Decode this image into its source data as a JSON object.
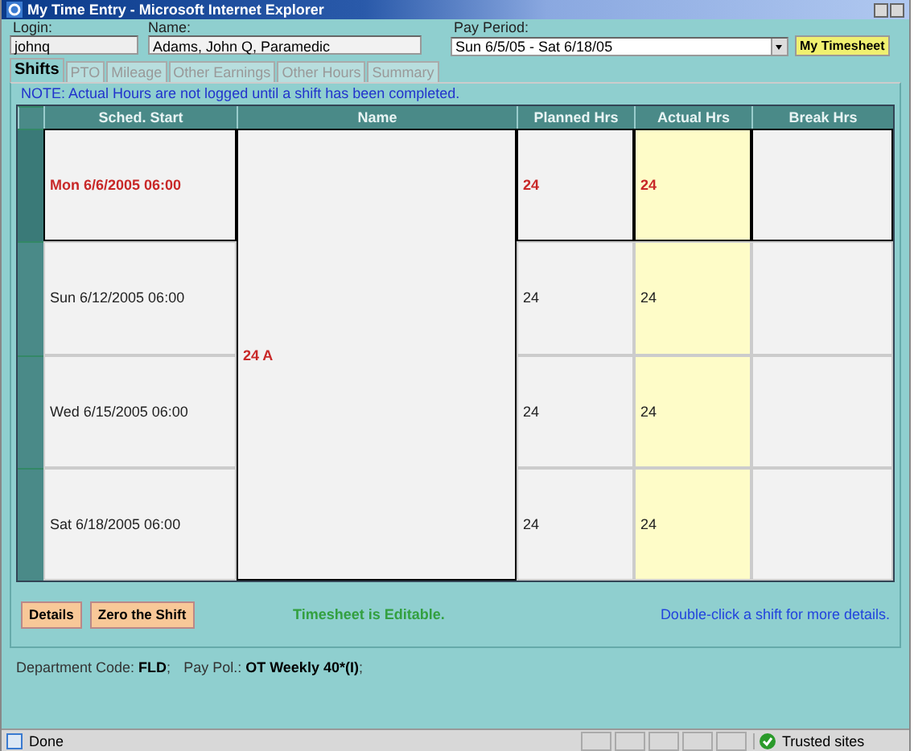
{
  "window": {
    "title": "My Time Entry - Microsoft Internet Explorer"
  },
  "fields": [
    {
      "kind": "text",
      "label": "Login:",
      "value": "johnq"
    },
    {
      "kind": "text",
      "label": "Name:",
      "value": "Adams, John Q, Paramedic"
    },
    {
      "kind": "select",
      "label": "Pay Period:",
      "value": "Sun 6/5/05 - Sat 6/18/05"
    }
  ],
  "timesheet_button": "My Timesheet",
  "tabs": [
    {
      "label": "Shifts",
      "selected": true
    },
    {
      "label": "PTO",
      "selected": false
    },
    {
      "label": "Mileage",
      "selected": false
    },
    {
      "label": "Other Earnings",
      "selected": false
    },
    {
      "label": "Other Hours",
      "selected": false
    },
    {
      "label": "Summary",
      "selected": false
    }
  ],
  "note": "NOTE: Actual Hours are not logged until a shift has been completed.",
  "table": {
    "columns": [
      "Sched. Start",
      "Name",
      "Planned Hrs",
      "Actual Hrs",
      "Break Hrs"
    ],
    "name_cell": "24 A",
    "rows": [
      {
        "sched_start": "Mon 6/6/2005 06:00",
        "planned": "24",
        "actual": "24",
        "selected": true
      },
      {
        "sched_start": "Sun 6/12/2005 06:00",
        "planned": "24",
        "actual": "24",
        "selected": false
      },
      {
        "sched_start": "Wed 6/15/2005 06:00",
        "planned": "24",
        "actual": "24",
        "selected": false
      },
      {
        "sched_start": "Sat 6/18/2005 06:00",
        "planned": "24",
        "actual": "24",
        "selected": false
      }
    ]
  },
  "buttons": [
    "Details",
    "Zero the Shift"
  ],
  "editable_message": "Timesheet is Editable.",
  "hint": "Double-click a shift for more details.",
  "footer": [
    {
      "label": "Department Code:",
      "value": "FLD",
      "end": ";"
    },
    {
      "label": "Pay Pol.:",
      "value": "OT Weekly 40*(I)",
      "end": ";"
    }
  ],
  "status_bar": {
    "text": "Done",
    "zone": "Trusted sites"
  }
}
